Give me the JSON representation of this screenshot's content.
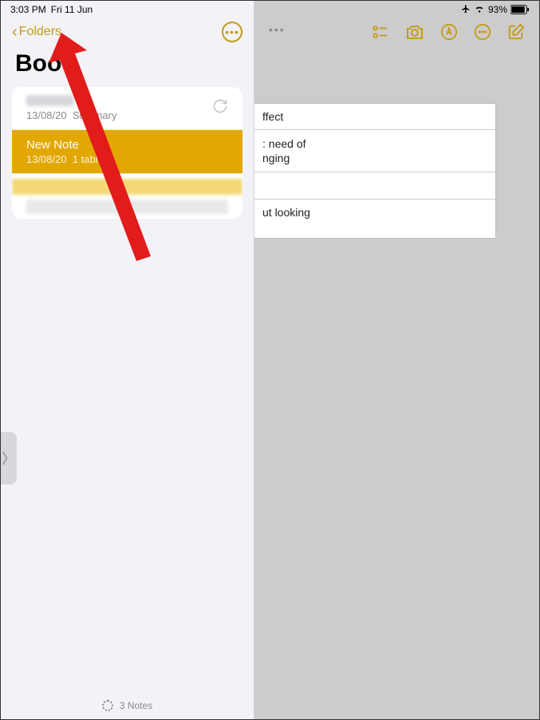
{
  "status": {
    "time": "3:03 PM",
    "date": "Fri 11 Jun",
    "battery_pct": "93%",
    "airplane": true
  },
  "sidebar": {
    "back_label": "Folders",
    "folder_title": "Boo",
    "notes": [
      {
        "title": "",
        "date": "13/08/20",
        "summary": "Summary",
        "showSync": true,
        "selected": false,
        "blurred_title": true
      },
      {
        "title": "New Note",
        "date": "13/08/20",
        "summary": "1 tabl",
        "showSync": false,
        "selected": true,
        "blurred_title": false
      }
    ],
    "footer_count": "3 Notes"
  },
  "main": {
    "content_lines": [
      "ffect",
      ": need of",
      "nging",
      "",
      "ut looking"
    ]
  },
  "colors": {
    "accent": "#c69a18",
    "selected": "#e2a700"
  }
}
